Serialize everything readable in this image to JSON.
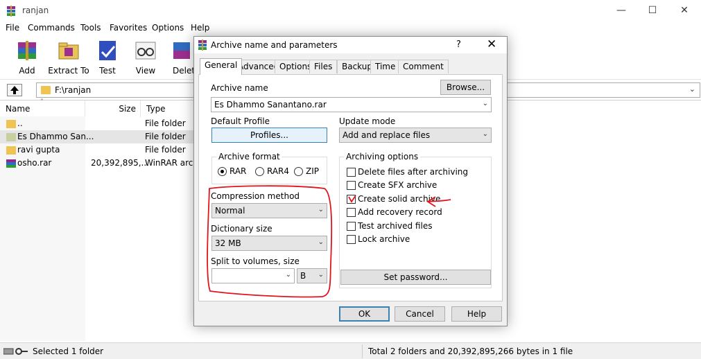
{
  "window": {
    "title": "ranjan",
    "minimize": "—",
    "maximize": "☐",
    "close": "✕"
  },
  "menu": [
    "File",
    "Commands",
    "Tools",
    "Favorites",
    "Options",
    "Help"
  ],
  "toolbar": {
    "add": "Add",
    "extract": "Extract To",
    "test": "Test",
    "view": "View",
    "delete": "Delete"
  },
  "address": {
    "path": "F:\\ranjan"
  },
  "columns": {
    "name": "Name",
    "size": "Size",
    "type": "Type"
  },
  "files": [
    {
      "name": "..",
      "size": "",
      "type": "File folder"
    },
    {
      "name": "Es Dhammo San...",
      "size": "",
      "type": "File folder"
    },
    {
      "name": "ravi gupta",
      "size": "",
      "type": "File folder"
    },
    {
      "name": "osho.rar",
      "size": "20,392,895,...",
      "type": "WinRAR arch"
    }
  ],
  "status": {
    "left": "Selected 1 folder",
    "right": "Total 2 folders and 20,392,895,266 bytes in 1 file"
  },
  "dialog": {
    "title": "Archive name and parameters",
    "help": "?",
    "close": "✕",
    "tabs": [
      "General",
      "Advanced",
      "Options",
      "Files",
      "Backup",
      "Time",
      "Comment"
    ],
    "archive_name_label": "Archive name",
    "browse": "Browse...",
    "archive_name_value": "Es Dhammo Sanantano.rar",
    "default_profile_label": "Default Profile",
    "profiles": "Profiles...",
    "update_mode_label": "Update mode",
    "update_mode_value": "Add and replace files",
    "archive_format_label": "Archive format",
    "formats": [
      "RAR",
      "RAR4",
      "ZIP"
    ],
    "selected_format": "RAR",
    "compression_label": "Compression method",
    "compression_value": "Normal",
    "dictionary_label": "Dictionary size",
    "dictionary_value": "32 MB",
    "split_label": "Split to volumes, size",
    "split_value": "",
    "split_unit": "B",
    "archiving_options_label": "Archiving options",
    "options": [
      {
        "label": "Delete files after archiving",
        "checked": false
      },
      {
        "label": "Create SFX archive",
        "checked": false
      },
      {
        "label": "Create solid archive",
        "checked": false
      },
      {
        "label": "Add recovery record",
        "checked": false
      },
      {
        "label": "Test archived files",
        "checked": false
      },
      {
        "label": "Lock archive",
        "checked": false
      }
    ],
    "set_password": "Set password...",
    "ok": "OK",
    "cancel": "Cancel",
    "help_button": "Help"
  },
  "annotation_color": "#e0141e"
}
